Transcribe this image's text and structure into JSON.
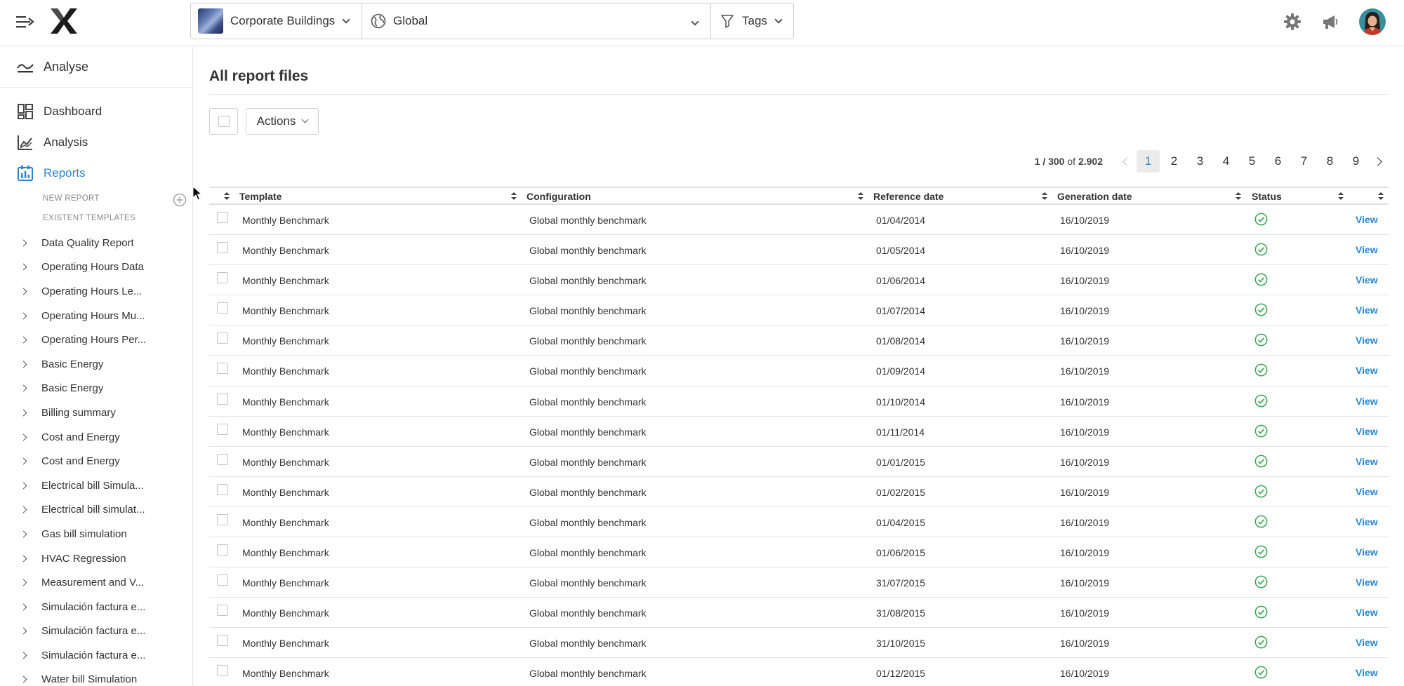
{
  "topbar": {
    "building_selector": "Corporate Buildings",
    "scope_selector": "Global",
    "tags_filter": "Tags"
  },
  "sidebar": {
    "section": "Analyse",
    "nav": [
      {
        "label": "Dashboard",
        "icon": "dashboard-icon"
      },
      {
        "label": "Analysis",
        "icon": "analysis-chart-icon"
      },
      {
        "label": "Reports",
        "icon": "reports-icon",
        "active": true
      }
    ],
    "new_report_label": "NEW REPORT",
    "existent_templates_label": "EXISTENT TEMPLATES",
    "templates": [
      "Data Quality Report",
      "Operating Hours Data",
      "Operating Hours Le...",
      "Operating Hours Mu...",
      "Operating Hours Per...",
      "Basic Energy",
      "Basic Energy",
      "Billing summary",
      "Cost and Energy",
      "Cost and Energy",
      "Electrical bill Simula...",
      "Electrical bill simulat...",
      "Gas bill simulation",
      "HVAC Regression",
      "Measurement and V...",
      "Simulación factura e...",
      "Simulación factura e...",
      "Simulación factura e...",
      "Water bill Simulation"
    ]
  },
  "main": {
    "title": "All report files",
    "actions_label": "Actions",
    "pagination": {
      "range": "1 / 300",
      "of_label": "of",
      "total": "2.902",
      "pages": [
        "1",
        "2",
        "3",
        "4",
        "5",
        "6",
        "7",
        "8",
        "9"
      ],
      "current_page": "1"
    },
    "table": {
      "columns": [
        "Template",
        "Configuration",
        "Reference date",
        "Generation date",
        "Status"
      ],
      "view_label": "View",
      "status_icon": "check-circle-icon",
      "status_color": "#3aa655",
      "rows": [
        {
          "template": "Monthly Benchmark",
          "configuration": "Global monthly benchmark",
          "reference_date": "01/04/2014",
          "generation_date": "16/10/2019"
        },
        {
          "template": "Monthly Benchmark",
          "configuration": "Global monthly benchmark",
          "reference_date": "01/05/2014",
          "generation_date": "16/10/2019"
        },
        {
          "template": "Monthly Benchmark",
          "configuration": "Global monthly benchmark",
          "reference_date": "01/06/2014",
          "generation_date": "16/10/2019"
        },
        {
          "template": "Monthly Benchmark",
          "configuration": "Global monthly benchmark",
          "reference_date": "01/07/2014",
          "generation_date": "16/10/2019"
        },
        {
          "template": "Monthly Benchmark",
          "configuration": "Global monthly benchmark",
          "reference_date": "01/08/2014",
          "generation_date": "16/10/2019"
        },
        {
          "template": "Monthly Benchmark",
          "configuration": "Global monthly benchmark",
          "reference_date": "01/09/2014",
          "generation_date": "16/10/2019"
        },
        {
          "template": "Monthly Benchmark",
          "configuration": "Global monthly benchmark",
          "reference_date": "01/10/2014",
          "generation_date": "16/10/2019"
        },
        {
          "template": "Monthly Benchmark",
          "configuration": "Global monthly benchmark",
          "reference_date": "01/11/2014",
          "generation_date": "16/10/2019"
        },
        {
          "template": "Monthly Benchmark",
          "configuration": "Global monthly benchmark",
          "reference_date": "01/01/2015",
          "generation_date": "16/10/2019"
        },
        {
          "template": "Monthly Benchmark",
          "configuration": "Global monthly benchmark",
          "reference_date": "01/02/2015",
          "generation_date": "16/10/2019"
        },
        {
          "template": "Monthly Benchmark",
          "configuration": "Global monthly benchmark",
          "reference_date": "01/04/2015",
          "generation_date": "16/10/2019"
        },
        {
          "template": "Monthly Benchmark",
          "configuration": "Global monthly benchmark",
          "reference_date": "01/06/2015",
          "generation_date": "16/10/2019"
        },
        {
          "template": "Monthly Benchmark",
          "configuration": "Global monthly benchmark",
          "reference_date": "31/07/2015",
          "generation_date": "16/10/2019"
        },
        {
          "template": "Monthly Benchmark",
          "configuration": "Global monthly benchmark",
          "reference_date": "31/08/2015",
          "generation_date": "16/10/2019"
        },
        {
          "template": "Monthly Benchmark",
          "configuration": "Global monthly benchmark",
          "reference_date": "31/10/2015",
          "generation_date": "16/10/2019"
        },
        {
          "template": "Monthly Benchmark",
          "configuration": "Global monthly benchmark",
          "reference_date": "01/12/2015",
          "generation_date": "16/10/2019"
        }
      ]
    }
  },
  "colors": {
    "accent": "#2a86d4",
    "success": "#3aa655",
    "text": "#333333",
    "border": "#e2e2e2"
  }
}
